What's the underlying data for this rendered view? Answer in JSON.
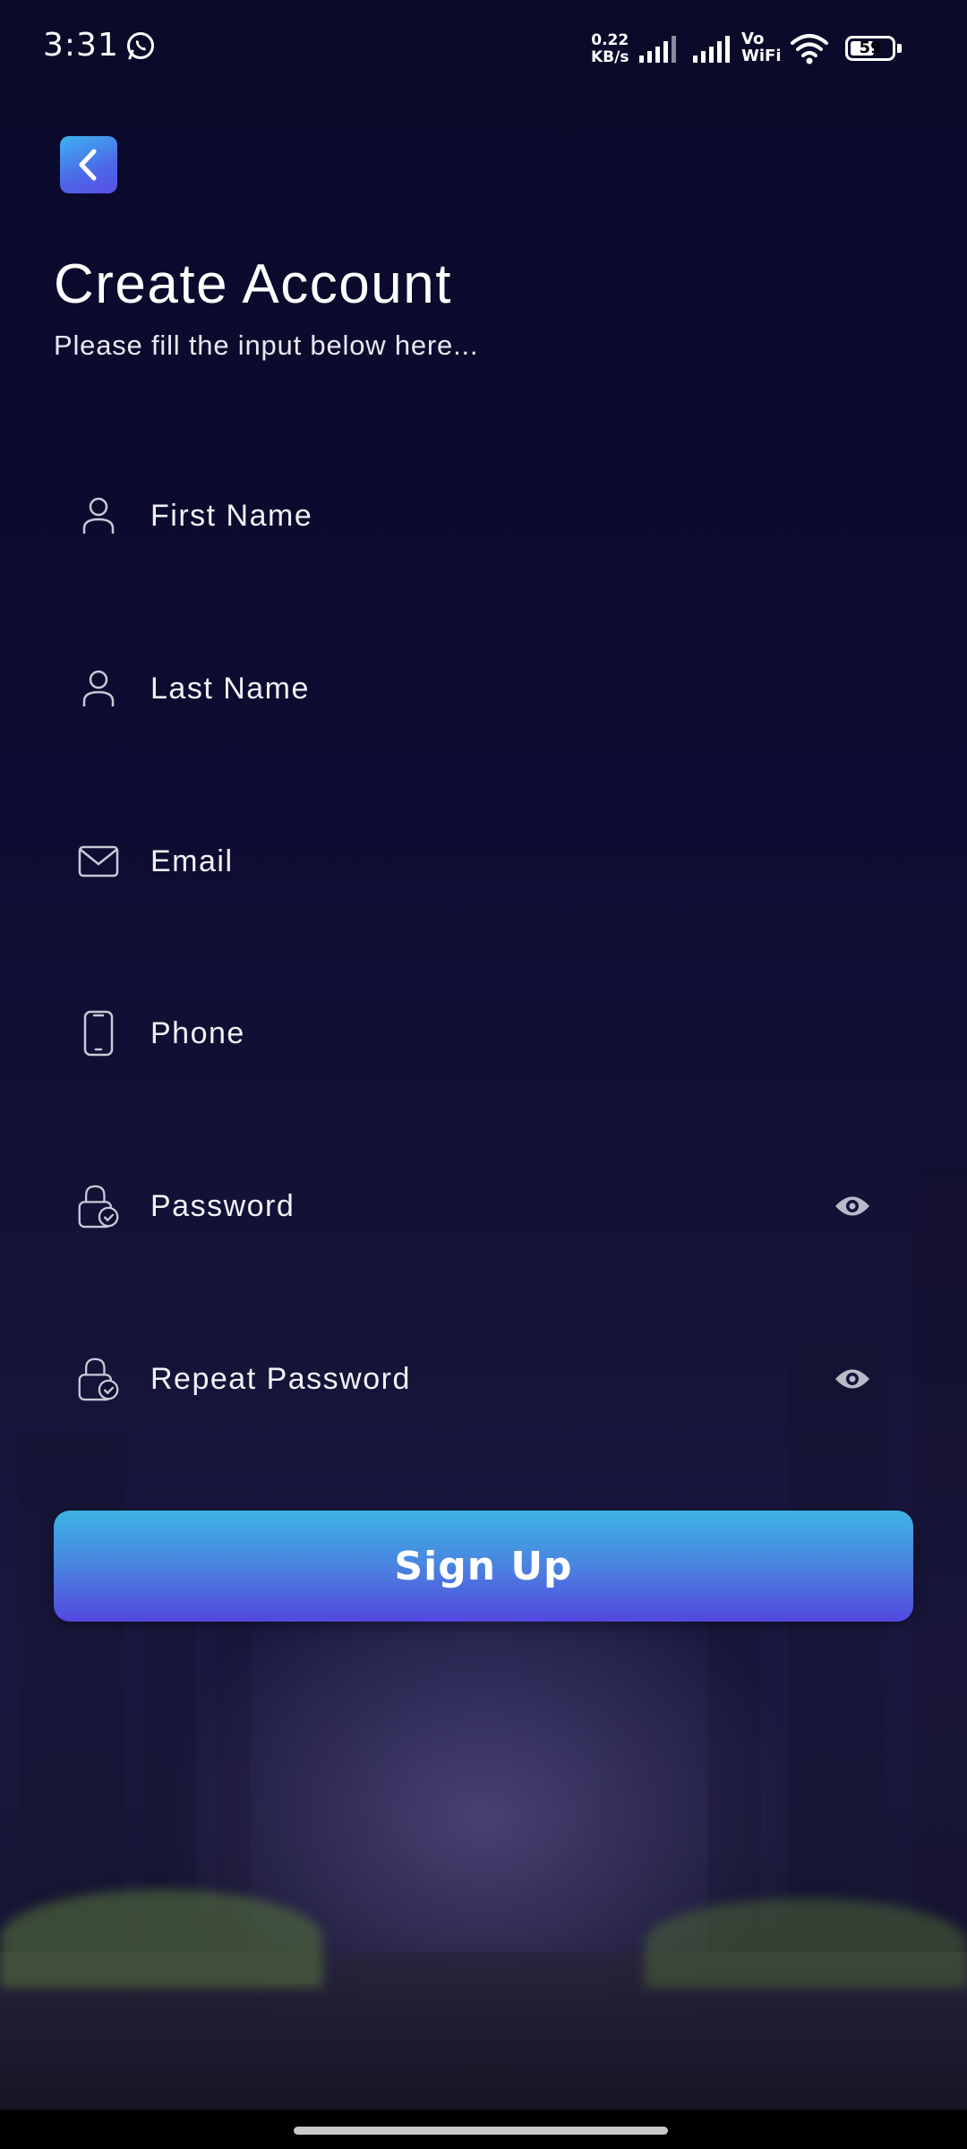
{
  "status_bar": {
    "time": "3:31",
    "net_speed_value": "0.22",
    "net_speed_unit": "KB/s",
    "vo_label": "Vo",
    "wifi_label": "WiFi",
    "battery": "59"
  },
  "header": {
    "title": "Create Account",
    "subtitle": "Please fill the input below here..."
  },
  "form": {
    "first_name_placeholder": "First Name",
    "last_name_placeholder": "Last Name",
    "email_placeholder": "Email",
    "phone_placeholder": "Phone",
    "password_placeholder": "Password",
    "repeat_password_placeholder": "Repeat Password"
  },
  "actions": {
    "signup_label": "Sign Up"
  },
  "colors": {
    "background": "#0b0a2c",
    "accent_start": "#3cb4e3",
    "accent_end": "#5348e0"
  }
}
